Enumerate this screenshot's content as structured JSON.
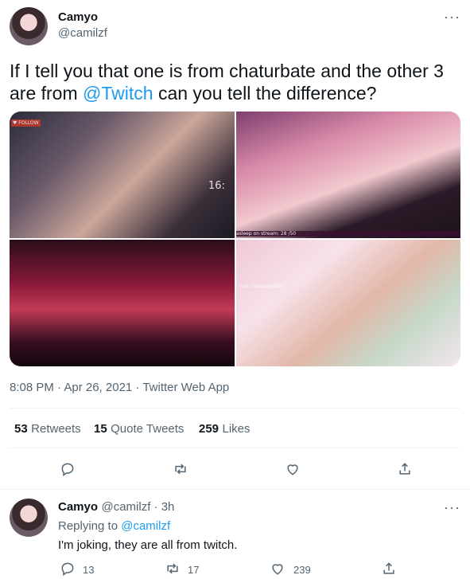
{
  "tweet": {
    "author_name": "Camyo",
    "author_handle": "@camilzf",
    "text_prefix": "If I tell you that one is from chaturbate and the other 3 are from ",
    "mention": "@Twitch",
    "text_suffix": " can you tell the difference?",
    "timestamp": "8:08 PM · Apr 26, 2021 · Twitter Web App",
    "stats": {
      "retweets_count": "53",
      "retweets_label": "Retweets",
      "quotes_count": "15",
      "quotes_label": "Quote Tweets",
      "likes_count": "259",
      "likes_label": "Likes"
    }
  },
  "reply": {
    "author_name": "Camyo",
    "author_meta": "@camilzf · 3h",
    "replying_prefix": "Replying to ",
    "replying_handle": "@camilzf",
    "text": "I'm joking, they are all from twitch.",
    "reply_count": "13",
    "retweet_count": "17",
    "like_count": "239"
  },
  "media_overlays": {
    "c1_follow": "♥ FOLLOW",
    "c1_timer": "16:",
    "c2_banner": "asleep on stream: 28 /50",
    "c4_note": "get names written"
  },
  "icons": [
    "more-icon",
    "reply-icon",
    "retweet-icon",
    "like-icon",
    "share-icon"
  ]
}
